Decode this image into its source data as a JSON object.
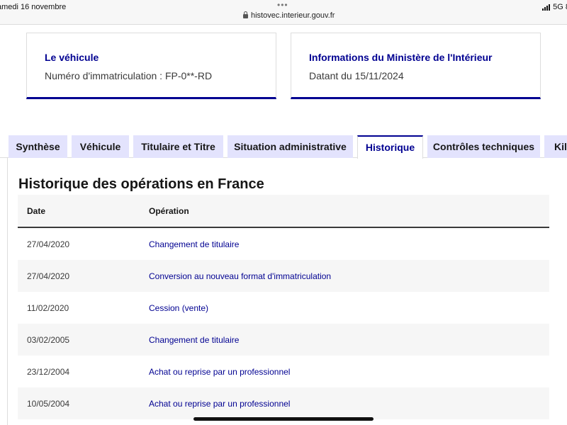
{
  "status_bar": {
    "date": "amedi 16 novembre",
    "dots": "•••",
    "url": "histovec.interieur.gouv.fr",
    "network": "5G 8"
  },
  "cards": {
    "vehicle": {
      "title": "Le véhicule",
      "text": "Numéro d'immatriculation : FP-0**-RD"
    },
    "ministry": {
      "title": "Informations du Ministère de l'Intérieur",
      "text": "Datant du 15/11/2024"
    }
  },
  "tabs": [
    {
      "label": "Synthèse",
      "active": false
    },
    {
      "label": "Véhicule",
      "active": false
    },
    {
      "label": "Titulaire et Titre",
      "active": false
    },
    {
      "label": "Situation administrative",
      "active": false
    },
    {
      "label": "Historique",
      "active": true
    },
    {
      "label": "Contrôles techniques",
      "active": false
    },
    {
      "label": "Kilo",
      "active": false
    }
  ],
  "history": {
    "title": "Historique des opérations en France",
    "columns": [
      "Date",
      "Opération"
    ],
    "rows": [
      {
        "date": "27/04/2020",
        "operation": "Changement de titulaire"
      },
      {
        "date": "27/04/2020",
        "operation": "Conversion au nouveau format d'immatriculation"
      },
      {
        "date": "11/02/2020",
        "operation": "Cession (vente)"
      },
      {
        "date": "03/02/2005",
        "operation": "Changement de titulaire"
      },
      {
        "date": "23/12/2004",
        "operation": "Achat ou reprise par un professionnel"
      },
      {
        "date": "10/05/2004",
        "operation": "Achat ou reprise par un professionnel"
      }
    ]
  },
  "colors": {
    "accent": "#000091",
    "tab_background": "#e3e3fd",
    "row_alt": "#f6f6f6"
  }
}
